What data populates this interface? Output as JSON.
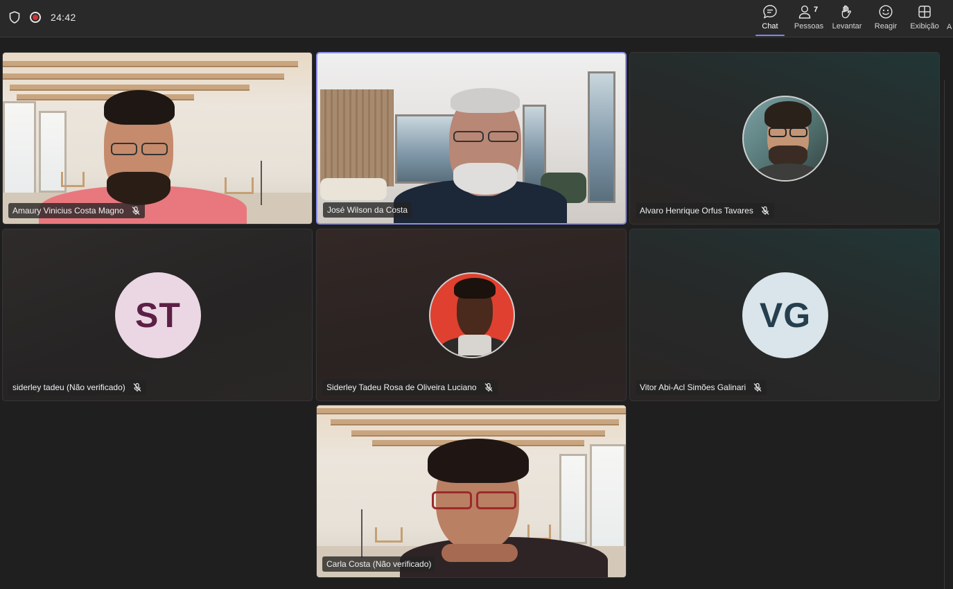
{
  "call": {
    "timer": "24:42"
  },
  "toolbar": {
    "chat_label": "Chat",
    "people_label": "Pessoas",
    "people_count": "7",
    "raise_label": "Levantar",
    "react_label": "Reagir",
    "view_label": "Exibição",
    "more_label_cut": "A"
  },
  "participants": [
    {
      "name": "Amaury Vinicius Costa Magno",
      "muted": true,
      "video": true
    },
    {
      "name": "José Wilson da Costa",
      "muted": false,
      "video": true,
      "active_speaker": true
    },
    {
      "name": "Alvaro Henrique Orfus Tavares",
      "muted": true,
      "video": false,
      "photo_avatar": true
    },
    {
      "name": "siderley tadeu (Não verificado)",
      "muted": true,
      "video": false,
      "initials": "ST"
    },
    {
      "name": "Siderley Tadeu Rosa de Oliveira Luciano",
      "muted": true,
      "video": false,
      "photo_avatar": true
    },
    {
      "name": "Vitor Abi-Acl Simões Galinari",
      "muted": true,
      "video": false,
      "initials": "VG"
    },
    {
      "name": "Carla Costa (Não verificado)",
      "muted": false,
      "video": true
    }
  ],
  "colors": {
    "accent": "#7f85f5",
    "recording": "#d13438",
    "st_avatar_bg": "#ead7e3",
    "st_avatar_fg": "#5c1f45",
    "vg_avatar_bg": "#d9e5ea",
    "vg_avatar_fg": "#253f4e"
  }
}
